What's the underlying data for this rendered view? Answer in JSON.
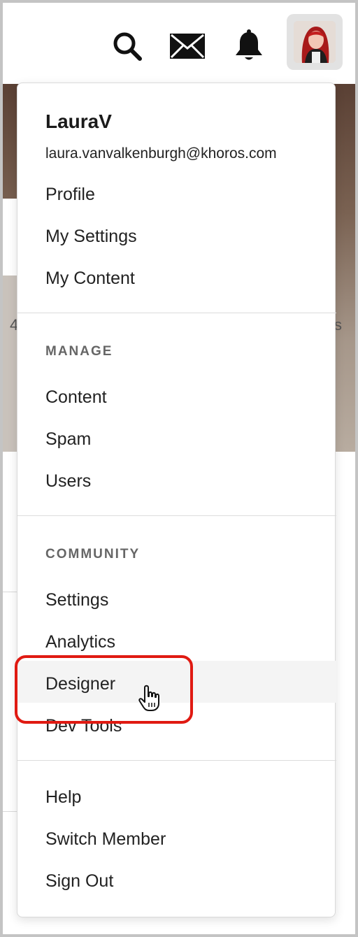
{
  "header": {
    "icons": [
      "search-icon",
      "mail-icon",
      "bell-icon"
    ],
    "avatar": "user-avatar"
  },
  "menu": {
    "user": {
      "name": "LauraV",
      "email": "laura.vanvalkenburgh@khoros.com"
    },
    "account_items": [
      "Profile",
      "My Settings",
      "My Content"
    ],
    "manage": {
      "heading": "MANAGE",
      "items": [
        "Content",
        "Spam",
        "Users"
      ]
    },
    "community": {
      "heading": "COMMUNITY",
      "items": [
        "Settings",
        "Analytics",
        "Designer",
        "Dev Tools"
      ]
    },
    "footer_items": [
      "Help",
      "Switch Member",
      "Sign Out"
    ]
  },
  "annotation": {
    "highlight_color": "#e01a12",
    "highlighted_item": "Designer"
  },
  "background": {
    "glyph_left": "4",
    "glyph_right": "s"
  }
}
